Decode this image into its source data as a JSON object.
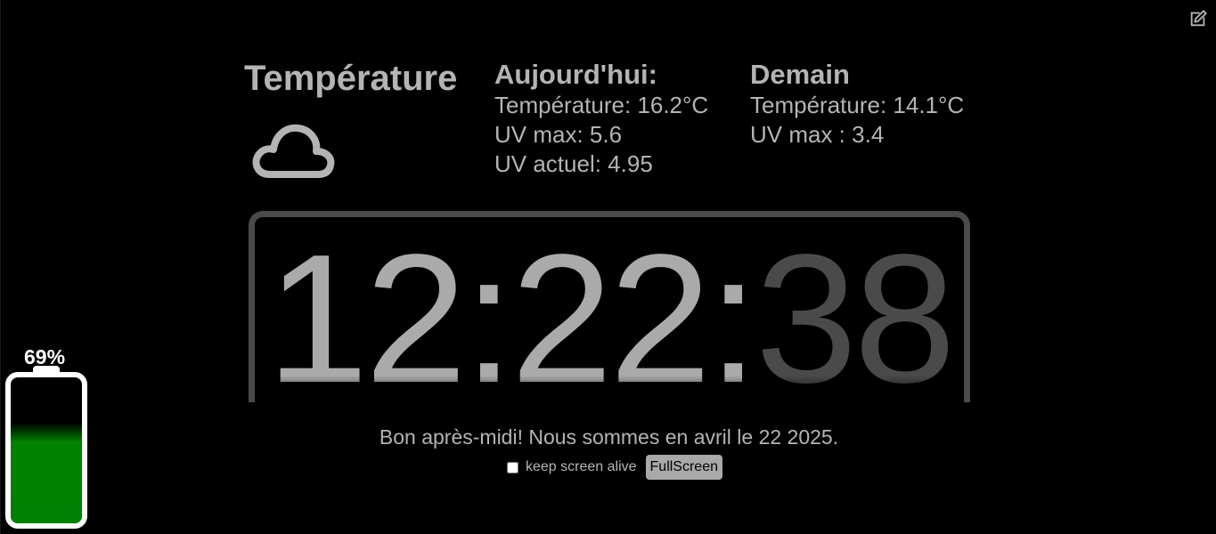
{
  "weather": {
    "title": "Température",
    "icon": "cloud-icon"
  },
  "today": {
    "heading": "Aujourd'hui:",
    "temperature": "Température: 16.2°C",
    "uv_max": "UV max: 5.6",
    "uv_current": "UV actuel: 4.95"
  },
  "tomorrow": {
    "heading": "Demain",
    "temperature": "Température: 14.1°C",
    "uv_max": "UV max : 3.4"
  },
  "clock": {
    "hours": "12",
    "minutes": "22",
    "seconds": "38",
    "separator": ":"
  },
  "greeting": "Bon après-midi! Nous sommes en avril le 22 2025.",
  "controls": {
    "keep_alive_label": "keep screen alive",
    "keep_alive_checked": false,
    "fullscreen_label": "FullScreen"
  },
  "battery": {
    "label": "69%",
    "level": 0.69
  },
  "toolbar": {
    "edit_icon": "edit-icon"
  },
  "colors": {
    "background": "#000000",
    "text": "#b4b4b4",
    "clock_main": "#aaaaaa",
    "clock_seconds": "#4a4a4a",
    "battery_fill": "#008000"
  }
}
